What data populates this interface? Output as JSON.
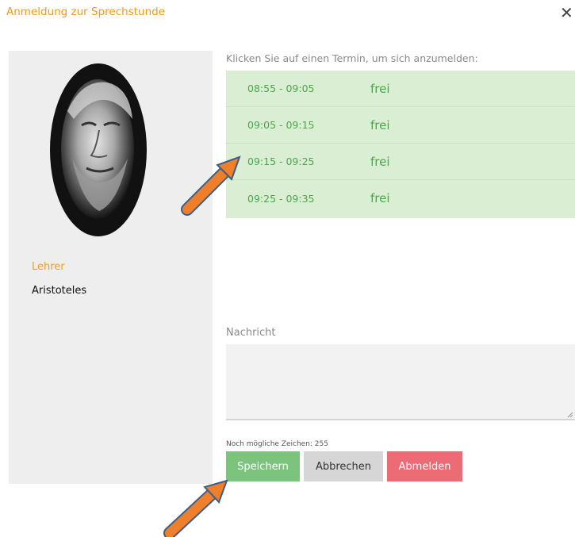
{
  "dialog": {
    "title": "Anmeldung zur Sprechstunde",
    "close_symbol": "✕"
  },
  "teacher": {
    "role": "Lehrer",
    "name": "Aristoteles",
    "portrait_icon": "portrait-photo"
  },
  "appointments": {
    "instruction": "Klicken Sie auf einen Termin, um sich anzumelden:",
    "slots": [
      {
        "time": "08:55 - 09:05",
        "status": "frei"
      },
      {
        "time": "09:05 - 09:15",
        "status": "frei"
      },
      {
        "time": "09:15 - 09:25",
        "status": "frei"
      },
      {
        "time": "09:25 - 09:35",
        "status": "frei"
      }
    ]
  },
  "message": {
    "label": "Nachricht",
    "value": "",
    "remaining_chars": "Noch mögliche Zeichen: 255"
  },
  "buttons": {
    "save": "Speichern",
    "cancel": "Abbrechen",
    "logout": "Abmelden"
  },
  "colors": {
    "accent": "#f09a1a",
    "slot_background": "#d9eed3",
    "slot_text": "#4ca64c",
    "save": "#7cc47e",
    "cancel": "#d6d6d6",
    "logout": "#ec6b74",
    "arrow": "#f07f2c"
  }
}
